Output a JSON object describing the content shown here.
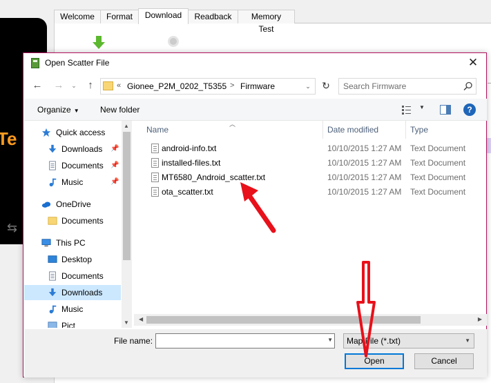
{
  "background_app": {
    "tabs": [
      "Welcome",
      "Format",
      "Download",
      "Readback",
      "Memory Test"
    ],
    "active_tab": "Download",
    "phone_text": "Te"
  },
  "dialog": {
    "title": "Open Scatter File",
    "close_glyph": "✕",
    "nav": {
      "back_glyph": "←",
      "forward_glyph": "→",
      "dropdown_glyph": "⌄",
      "up_glyph": "↑"
    },
    "address": {
      "overflow": "«",
      "crumbs": [
        "Gionee_P2M_0202_T5355",
        "Firmware"
      ],
      "separator": ">",
      "refresh_glyph": "↻"
    },
    "search": {
      "placeholder": "Search Firmware"
    },
    "commands": {
      "organize": "Organize",
      "new_folder": "New folder",
      "help": "?"
    },
    "sidebar": {
      "items": [
        {
          "label": "Quick access",
          "icon": "star-icon",
          "pinned": false
        },
        {
          "label": "Downloads",
          "icon": "download-icon",
          "pinned": true
        },
        {
          "label": "Documents",
          "icon": "documents-icon",
          "pinned": true
        },
        {
          "label": "Music",
          "icon": "music-icon",
          "pinned": true
        },
        {
          "label": "OneDrive",
          "icon": "cloud-icon",
          "pinned": false
        },
        {
          "label": "Documents",
          "icon": "folder-icon",
          "pinned": false
        },
        {
          "label": "This PC",
          "icon": "computer-icon",
          "pinned": false
        },
        {
          "label": "Desktop",
          "icon": "desktop-icon",
          "pinned": false
        },
        {
          "label": "Documents",
          "icon": "documents-icon",
          "pinned": false
        },
        {
          "label": "Downloads",
          "icon": "download-icon",
          "pinned": false,
          "selected": true
        },
        {
          "label": "Music",
          "icon": "music-icon",
          "pinned": false
        },
        {
          "label": "Pict",
          "icon": "pictures-icon",
          "pinned": false
        }
      ]
    },
    "columns": {
      "name": "Name",
      "date": "Date modified",
      "type": "Type"
    },
    "files": [
      {
        "name": "android-info.txt",
        "date": "10/10/2015 1:27 AM",
        "type": "Text Document"
      },
      {
        "name": "installed-files.txt",
        "date": "10/10/2015 1:27 AM",
        "type": "Text Document"
      },
      {
        "name": "MT6580_Android_scatter.txt",
        "date": "10/10/2015 1:27 AM",
        "type": "Text Document"
      },
      {
        "name": "ota_scatter.txt",
        "date": "10/10/2015 1:27 AM",
        "type": "Text Document"
      }
    ],
    "footer": {
      "file_name_label": "File name:",
      "file_name_value": "",
      "file_type": "Map File (*.txt)",
      "open": "Open",
      "cancel": "Cancel"
    }
  },
  "colors": {
    "dialog_border": "#b3125e",
    "selection": "#cce8ff",
    "annotation_red": "#e8101a",
    "accent_blue": "#0078d7"
  }
}
